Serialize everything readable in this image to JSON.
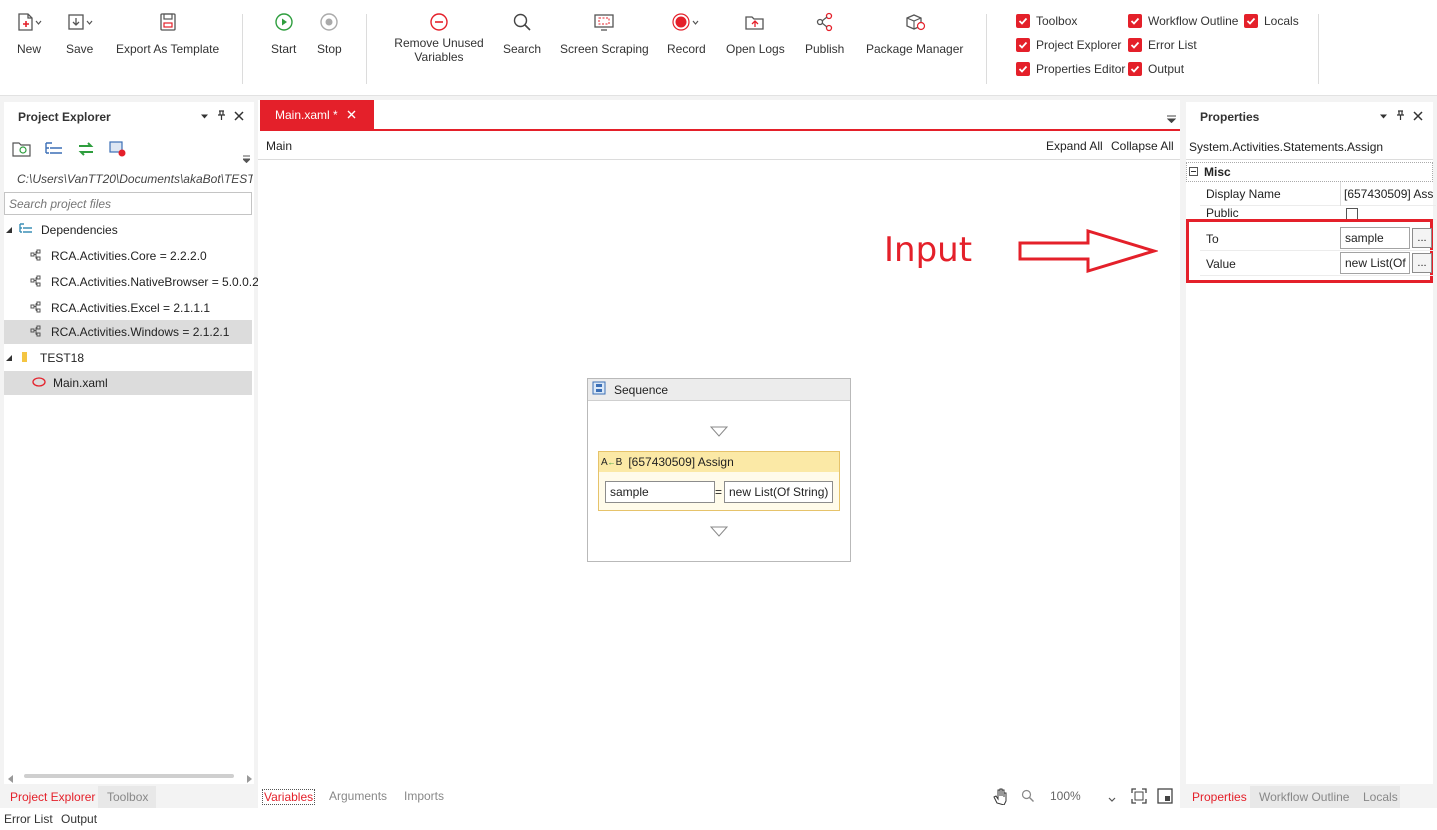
{
  "toolbar": {
    "new_label": "New",
    "save_label": "Save",
    "export_label": "Export As Template",
    "start_label": "Start",
    "stop_label": "Stop",
    "remove_unused_line1": "Remove Unused",
    "remove_unused_line2": "Variables",
    "search_label": "Search",
    "screen_scraping_label": "Screen Scraping",
    "record_label": "Record",
    "open_logs_label": "Open Logs",
    "publish_label": "Publish",
    "package_manager_label": "Package Manager",
    "toggles": {
      "toolbox": "Toolbox",
      "project_explorer": "Project Explorer",
      "properties_editor": "Properties Editor",
      "workflow_outline": "Workflow Outline",
      "error_list": "Error List",
      "output": "Output",
      "locals": "Locals"
    }
  },
  "project_explorer": {
    "title": "Project Explorer",
    "path": "C:\\Users\\VanTT20\\Documents\\akaBot\\TEST",
    "search_placeholder": "Search project files",
    "dependencies_label": "Dependencies",
    "dependencies": [
      "RCA.Activities.Core = 2.2.2.0",
      "RCA.Activities.NativeBrowser = 5.0.0.2",
      "RCA.Activities.Excel = 2.1.1.1",
      "RCA.Activities.Windows = 2.1.2.1"
    ],
    "project_folder": "TEST18",
    "main_file": "Main.xaml",
    "bottom_tabs": [
      "Project Explorer",
      "Toolbox"
    ]
  },
  "designer": {
    "tab_label": "Main.xaml *",
    "breadcrumb": "Main",
    "expand_all": "Expand All",
    "collapse_all": "Collapse All",
    "sequence_title": "Sequence",
    "assign_title": "[657430509] Assign",
    "assign_to": "sample",
    "assign_equals": "=",
    "assign_value": "new List(Of String)",
    "annotation": "Input",
    "bottom_tabs": [
      "Variables",
      "Arguments",
      "Imports"
    ],
    "zoom": "100%"
  },
  "properties": {
    "title": "Properties",
    "type_name": "System.Activities.Statements.Assign",
    "category": "Misc",
    "display_name_label": "Display Name",
    "display_name_value": "[657430509] Assi",
    "public_label": "Public",
    "to_label": "To",
    "to_value": "sample",
    "value_label": "Value",
    "value_value": "new List(Of",
    "ellipsis": "...",
    "bottom_tabs": [
      "Properties",
      "Workflow Outline",
      "Locals"
    ]
  },
  "status_tabs": [
    "Error List",
    "Output"
  ],
  "colors": {
    "accent": "#e4202a",
    "start_green": "#2e9e3e"
  }
}
